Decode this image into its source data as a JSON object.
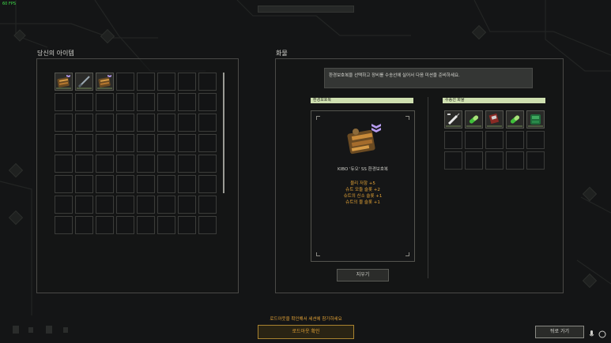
{
  "fps": "60 FPS",
  "inventory": {
    "title": "당신의 아이템",
    "slots": [
      {
        "filled": true,
        "icon": "armor-suit-icon"
      },
      {
        "filled": true,
        "icon": "rod-tool-icon"
      },
      {
        "filled": true,
        "icon": "armor-suit-icon"
      }
    ],
    "total_slots": 64
  },
  "cargo": {
    "title": "화물",
    "notice": "환경보호복을 선택하고 장비를 수송선에 실어서 다음 미션을 준비하세요.",
    "suit_header": "환경보호복",
    "suit_name": "KIBO '듀오' SS 환경보호복",
    "stats": [
      "물리 저항 +5",
      "슈트 모듈 슬롯 +2",
      "슈트의 신소 슬롯 +1",
      "슈트의 물 슬롯 +1"
    ],
    "clear_button": "지우기",
    "ship_header": "수송선 화물",
    "ship_slots": [
      {
        "filled": true,
        "icon": "syringe-icon"
      },
      {
        "filled": true,
        "icon": "green-capsule-icon"
      },
      {
        "filled": true,
        "icon": "red-device-icon"
      },
      {
        "filled": true,
        "icon": "green-capsule-icon"
      },
      {
        "filled": true,
        "icon": "green-pack-icon"
      }
    ],
    "ship_total_slots": 15
  },
  "footer": {
    "instruction": "로드아웃을 확인해서 세션에 참가하세요",
    "confirm_button": "로드아웃 확인",
    "back_button": "뒤로 가기"
  },
  "colors": {
    "accent": "#e2a236",
    "header_bg": "#cfe0b0",
    "fps": "#3fe04a"
  }
}
